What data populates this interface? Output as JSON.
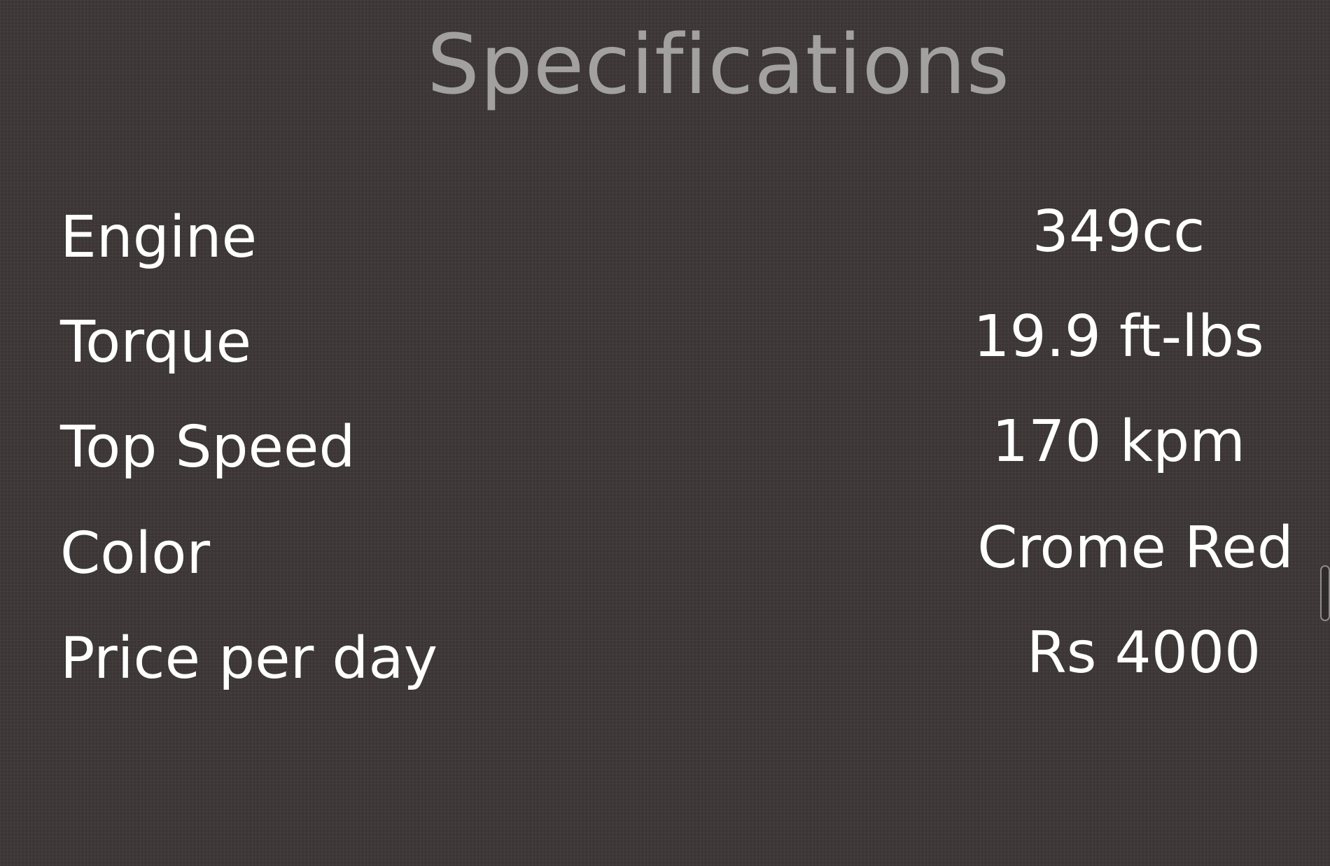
{
  "page": {
    "title": "Specifications"
  },
  "specs": [
    {
      "label": "Engine",
      "value": "349cc"
    },
    {
      "label": "Torque",
      "value": "19.9 ft-lbs"
    },
    {
      "label": "Top Speed",
      "value": "170 kpm"
    },
    {
      "label": " Color",
      "value": "Crome Red"
    },
    {
      "label": "Price per day",
      "value": "Rs 4000"
    }
  ],
  "colors": {
    "background": "#3b3535",
    "title": "#a3a0a0",
    "text": "#ffffff"
  }
}
